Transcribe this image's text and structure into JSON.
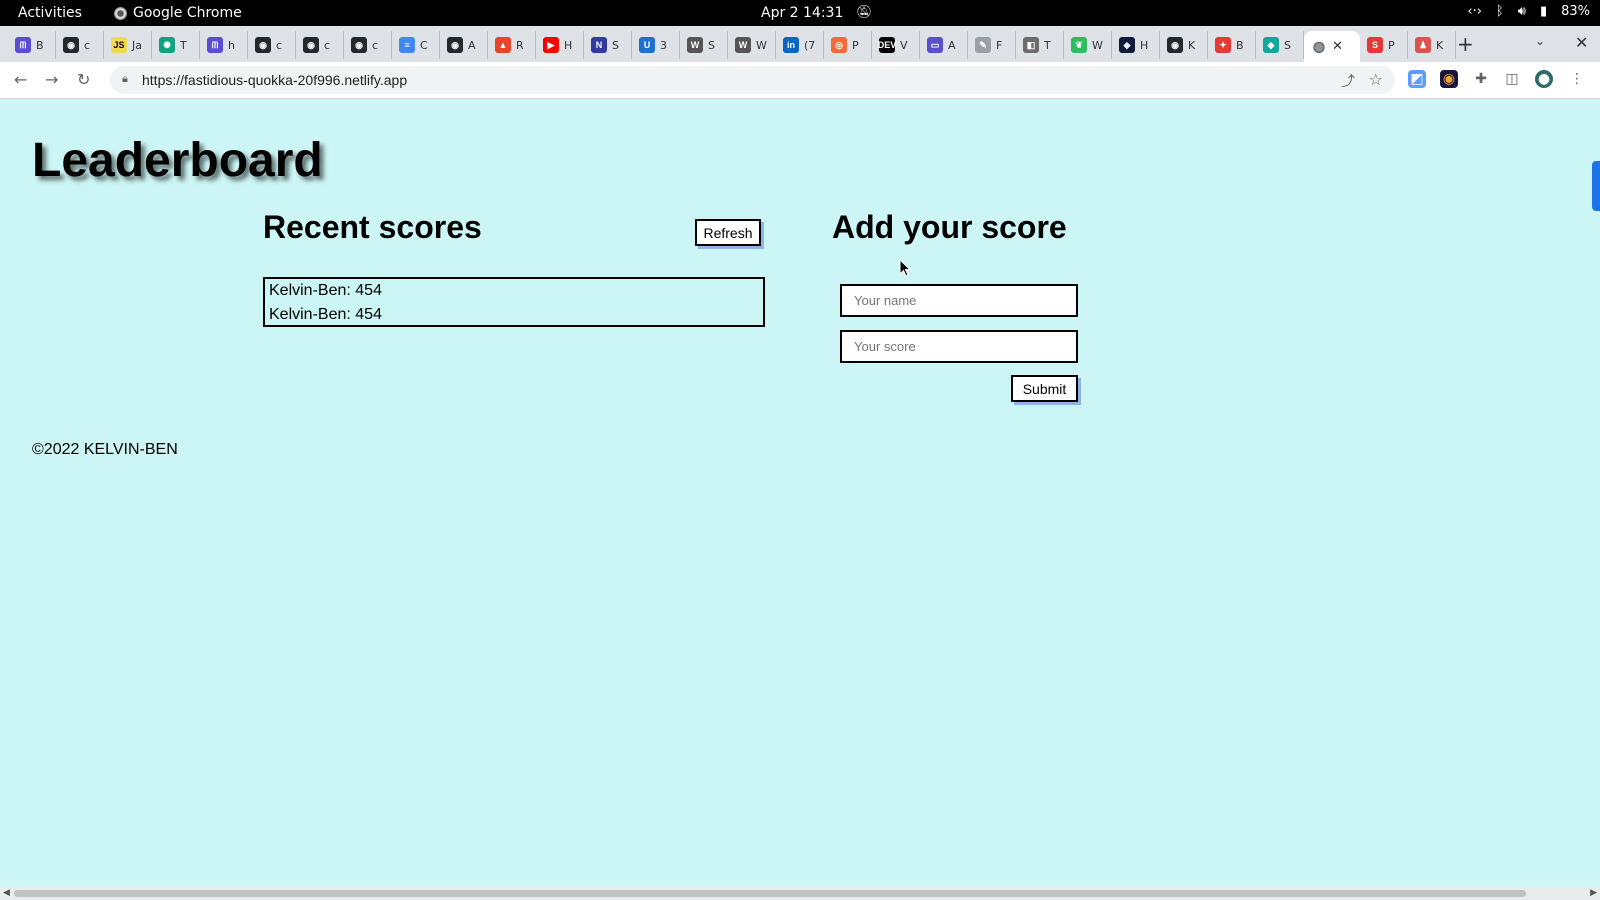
{
  "topbar": {
    "activities": "Activities",
    "app_name": "Google Chrome",
    "clock": "Apr 2  14:31",
    "battery": "83%"
  },
  "tabs": [
    {
      "letter": "B",
      "color": "#5b4bd6",
      "glyph": "ᗰ"
    },
    {
      "letter": "c",
      "color": "#24292f",
      "glyph": "◉"
    },
    {
      "letter": "Ja",
      "color": "#f0db4f",
      "glyph": "JS"
    },
    {
      "letter": "T",
      "color": "#10a37f",
      "glyph": "✺"
    },
    {
      "letter": "h",
      "color": "#5b4bd6",
      "glyph": "ᗰ"
    },
    {
      "letter": "c",
      "color": "#24292f",
      "glyph": "◉"
    },
    {
      "letter": "c",
      "color": "#24292f",
      "glyph": "◉"
    },
    {
      "letter": "c",
      "color": "#24292f",
      "glyph": "◉"
    },
    {
      "letter": "C",
      "color": "#4285f4",
      "glyph": "≡"
    },
    {
      "letter": "A",
      "color": "#24292f",
      "glyph": "◉"
    },
    {
      "letter": "R",
      "color": "#e8432d",
      "glyph": "▲"
    },
    {
      "letter": "H",
      "color": "#ff0000",
      "glyph": "▶"
    },
    {
      "letter": "S",
      "color": "#2f3b9e",
      "glyph": "N"
    },
    {
      "letter": "3",
      "color": "#1f6fd1",
      "glyph": "U"
    },
    {
      "letter": "S",
      "color": "#555555",
      "glyph": "W"
    },
    {
      "letter": "W",
      "color": "#555555",
      "glyph": "W"
    },
    {
      "letter": "(7",
      "color": "#0a66c2",
      "glyph": "in"
    },
    {
      "letter": "P",
      "color": "#f26b3a",
      "glyph": "◎"
    },
    {
      "letter": "V",
      "color": "#000000",
      "glyph": "DEV"
    },
    {
      "letter": "A",
      "color": "#5a4fcf",
      "glyph": "▭"
    },
    {
      "letter": "F",
      "color": "#9aa0a6",
      "glyph": "✎"
    },
    {
      "letter": "T",
      "color": "#6b6b6b",
      "glyph": "◧"
    },
    {
      "letter": "W",
      "color": "#2dbe60",
      "glyph": "❦"
    },
    {
      "letter": "H",
      "color": "#101b3b",
      "glyph": "◈"
    },
    {
      "letter": "K",
      "color": "#24292f",
      "glyph": "◉"
    },
    {
      "letter": "B",
      "color": "#e53935",
      "glyph": "✦"
    },
    {
      "letter": "S",
      "color": "#13a89e",
      "glyph": "◆"
    }
  ],
  "active_tab_glyph": "◍",
  "trailing_tabs": [
    {
      "letter": "P",
      "color": "#e53935",
      "glyph": "S"
    },
    {
      "letter": "K",
      "color": "#d9534f",
      "glyph": "♟"
    }
  ],
  "address_bar": {
    "url": "https://fastidious-quokka-20f996.netlify.app"
  },
  "page": {
    "title": "Leaderboard",
    "recent_heading": "Recent scores",
    "refresh_label": "Refresh",
    "scores": [
      "Kelvin-Ben: 454",
      "Kelvin-Ben: 454"
    ],
    "add_heading": "Add your score",
    "name_placeholder": "Your name",
    "score_placeholder": "Your score",
    "submit_label": "Submit",
    "footer": "©2022 KELVIN-BEN"
  },
  "colors": {
    "page_background": "#ccf5f5",
    "button_shadow": "#8fb3e8"
  }
}
